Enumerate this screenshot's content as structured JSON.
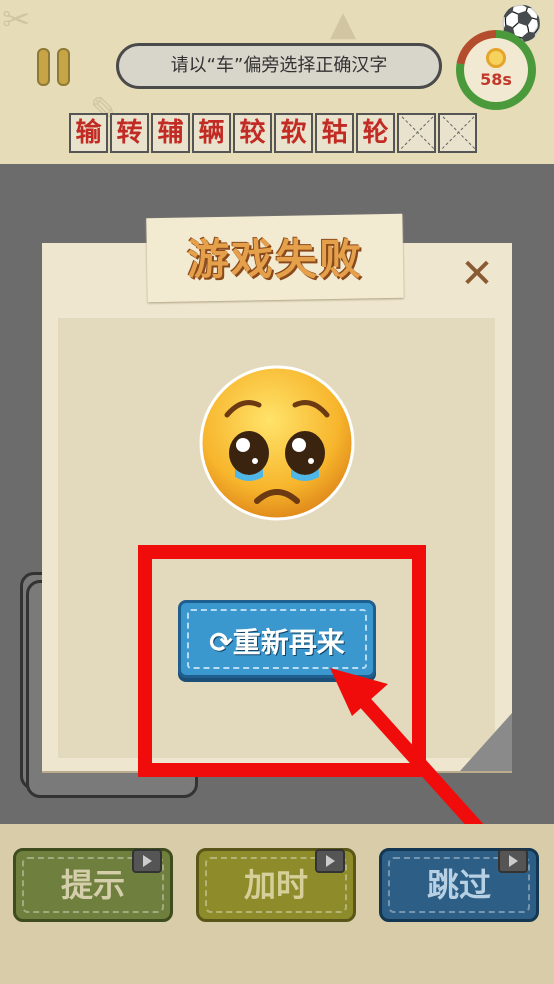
{
  "header": {
    "question": "请以“车”偏旁选择正确汉字",
    "timer": "58s",
    "answers": [
      "输",
      "转",
      "辅",
      "辆",
      "较",
      "软",
      "轱",
      "轮",
      "",
      ""
    ]
  },
  "popup": {
    "title": "游戏失败",
    "retry_label": "重新再来"
  },
  "bottom": {
    "hint_label": "提示",
    "addtime_label": "加时",
    "skip_label": "跳过"
  },
  "colors": {
    "highlight_red": "#f10c0c",
    "retry_blue": "#3b98cf"
  }
}
